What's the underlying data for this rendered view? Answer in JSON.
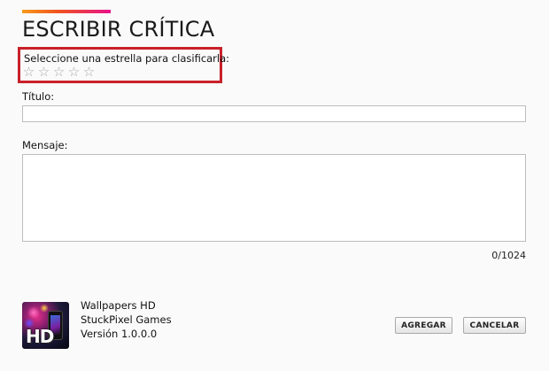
{
  "header": {
    "title": "ESCRIBIR CRÍTICA",
    "accent_colors": [
      "#f79a1e",
      "#f0551e",
      "#e8128b"
    ]
  },
  "rating": {
    "prompt": "Seleccione una estrella para clasificarla:",
    "stars": [
      "☆",
      "☆",
      "☆",
      "☆",
      "☆"
    ],
    "selected": 0,
    "highlight_color": "#c8202a"
  },
  "form": {
    "title_label": "Título:",
    "title_value": "",
    "message_label": "Mensaje:",
    "message_value": "",
    "char_count": "0/1024"
  },
  "app": {
    "icon_name": "wallpapers-hd-app-icon",
    "icon_text": "HD",
    "name": "Wallpapers HD",
    "developer": "StuckPixel Games",
    "version": "Versión 1.0.0.0"
  },
  "actions": {
    "add_label": "AGREGAR",
    "cancel_label": "CANCELAR"
  }
}
